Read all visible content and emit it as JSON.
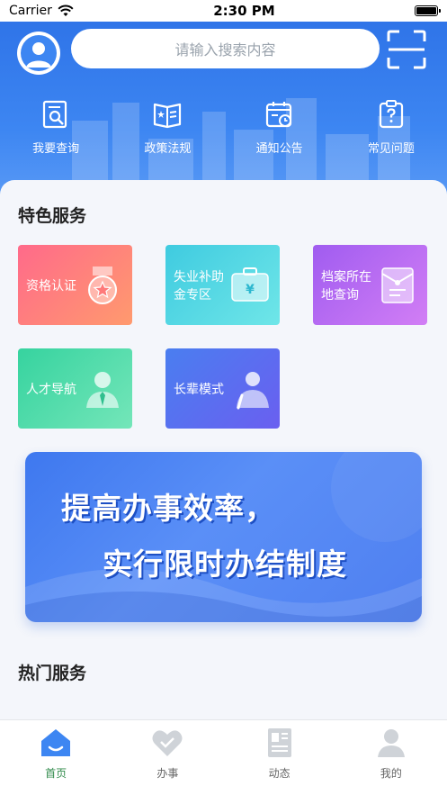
{
  "status_bar": {
    "carrier": "Carrier",
    "time": "2:30 PM"
  },
  "header": {
    "search_placeholder": "请输入搜索内容",
    "quick_links": [
      {
        "label": "我要查询",
        "icon": "search-document-icon"
      },
      {
        "label": "政策法规",
        "icon": "policy-book-icon"
      },
      {
        "label": "通知公告",
        "icon": "calendar-clock-icon"
      },
      {
        "label": "常见问题",
        "icon": "question-clipboard-icon"
      }
    ]
  },
  "featured": {
    "title": "特色服务",
    "items": [
      {
        "line1": "资格认证",
        "line2": "",
        "icon": "medal-icon",
        "color_from": "#ff6a8a",
        "color_to": "#ff9a6e"
      },
      {
        "line1": "失业补助",
        "line2": "金专区",
        "icon": "money-briefcase-icon",
        "color_from": "#3fcbe0",
        "color_to": "#6fe6e8"
      },
      {
        "line1": "档案所在",
        "line2": "地查询",
        "icon": "archive-folder-icon",
        "color_from": "#a05cf0",
        "color_to": "#d27ef5"
      },
      {
        "line1": "人才导航",
        "line2": "",
        "icon": "person-tie-icon",
        "color_from": "#36d39f",
        "color_to": "#74e6b9"
      },
      {
        "line1": "长辈模式",
        "line2": "",
        "icon": "elder-person-icon",
        "color_from": "#4a7ef0",
        "color_to": "#6a5ff0"
      }
    ]
  },
  "banner": {
    "line1": "提高办事效率，",
    "line2": "实行限时办结制度"
  },
  "hot": {
    "title": "热门服务"
  },
  "tabbar": [
    {
      "label": "首页",
      "icon": "home-icon",
      "active": true
    },
    {
      "label": "办事",
      "icon": "heart-icon",
      "active": false
    },
    {
      "label": "动态",
      "icon": "news-icon",
      "active": false
    },
    {
      "label": "我的",
      "icon": "user-icon",
      "active": false
    }
  ],
  "colors": {
    "primary": "#3d86f2",
    "tab_active": "#2f8a4a"
  }
}
